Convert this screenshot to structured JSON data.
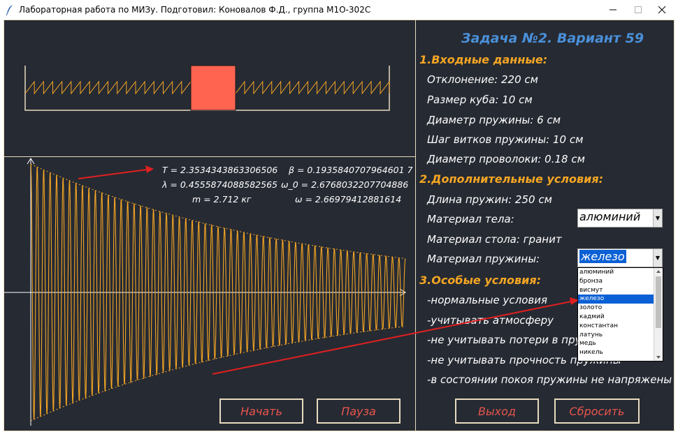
{
  "window": {
    "title": "Лабораторная работа по МИЗу. Подготовил: Коновалов Ф.Д., группа М1О-302С",
    "icon": "feather-icon"
  },
  "colors": {
    "background": "#262a33",
    "border": "#e8dcc0",
    "cube": "#ff6450",
    "wave": "#f5a623",
    "section": "#f5a623",
    "title": "#4a90d9",
    "button_text": "#e8554d",
    "arrow": "#e02020"
  },
  "formulas": {
    "T": "T = 2.3534343863306506",
    "beta": "β = 0.1935840707964601 7",
    "lambda": "λ = 0.4555874088582565",
    "omega0": "ω_0 = 2.6768032207704886",
    "m": "m = 2.712 кг",
    "omega": "ω = 2.66979412881614"
  },
  "task": {
    "title": "Задача №2. Вариант 59",
    "input_header": "1.Входные данные:",
    "deviation": "Отклонение: 220 см",
    "cube_size": "Размер куба: 10 см",
    "spring_diameter": "Диаметр пружины: 6 см",
    "coil_step": "Шаг витков пружины: 10 см",
    "wire_diameter": "Диаметр проволоки: 0.18 см",
    "extra_header": "2.Дополнительные условия:",
    "spring_length": "Длина пружин: 250 см",
    "body_material_label": "Материал тела:",
    "body_material_value": "алюминий",
    "table_material": "Материал стола: гранит",
    "spring_material_label": "Материал пружины:",
    "spring_material_value": "железо",
    "special_header": "3.Особые условия:",
    "cond1": "-нормальные условия",
    "cond2": "-учитывать атмосферу",
    "cond3": "-не учитывать потери в пружинах",
    "cond4": "-не учитывать прочность пружины",
    "cond5": "-в состоянии покоя пружины не напряжены"
  },
  "dropdown": {
    "items": [
      "алюминий",
      "бронза",
      "висмут",
      "железо",
      "золото",
      "кадмий",
      "константан",
      "латунь",
      "медь",
      "никель"
    ],
    "selected_index": 3
  },
  "buttons": {
    "start": "Начать",
    "pause": "Пауза",
    "exit": "Выход",
    "reset": "Сбросить"
  },
  "simulation": {
    "cycles": 58,
    "damping": 0.19358407079646017
  }
}
